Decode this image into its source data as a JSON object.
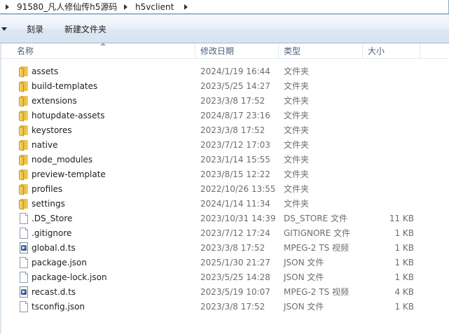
{
  "address": {
    "segments": [
      "91580_凡人修仙传h5源码",
      "h5vclient"
    ]
  },
  "toolbar": {
    "burn_label": "刻录",
    "new_folder_label": "新建文件夹"
  },
  "columns": {
    "name": "名称",
    "modified": "修改日期",
    "type": "类型",
    "size": "大小"
  },
  "files": [
    {
      "name": "assets",
      "modified": "2024/1/19 16:44",
      "type": "文件夹",
      "size": "",
      "icon": "folder-icon"
    },
    {
      "name": "build-templates",
      "modified": "2023/5/25 14:27",
      "type": "文件夹",
      "size": "",
      "icon": "folder-icon"
    },
    {
      "name": "extensions",
      "modified": "2023/3/8 17:52",
      "type": "文件夹",
      "size": "",
      "icon": "folder-icon"
    },
    {
      "name": "hotupdate-assets",
      "modified": "2024/8/17 23:16",
      "type": "文件夹",
      "size": "",
      "icon": "folder-icon"
    },
    {
      "name": "keystores",
      "modified": "2023/3/8 17:52",
      "type": "文件夹",
      "size": "",
      "icon": "folder-icon"
    },
    {
      "name": "native",
      "modified": "2023/7/12 17:03",
      "type": "文件夹",
      "size": "",
      "icon": "folder-icon"
    },
    {
      "name": "node_modules",
      "modified": "2023/1/14 15:55",
      "type": "文件夹",
      "size": "",
      "icon": "folder-icon"
    },
    {
      "name": "preview-template",
      "modified": "2023/8/15 12:22",
      "type": "文件夹",
      "size": "",
      "icon": "folder-icon"
    },
    {
      "name": "profiles",
      "modified": "2022/10/26 13:55",
      "type": "文件夹",
      "size": "",
      "icon": "folder-icon"
    },
    {
      "name": "settings",
      "modified": "2024/1/14 11:34",
      "type": "文件夹",
      "size": "",
      "icon": "folder-icon"
    },
    {
      "name": ".DS_Store",
      "modified": "2023/10/31 14:39",
      "type": "DS_STORE 文件",
      "size": "11 KB",
      "icon": "file-icon"
    },
    {
      "name": ".gitignore",
      "modified": "2023/7/12 17:24",
      "type": "GITIGNORE 文件",
      "size": "1 KB",
      "icon": "file-icon"
    },
    {
      "name": "global.d.ts",
      "modified": "2023/3/8 17:52",
      "type": "MPEG-2 TS 视频",
      "size": "1 KB",
      "icon": "video-file-icon"
    },
    {
      "name": "package.json",
      "modified": "2025/1/30 21:27",
      "type": "JSON 文件",
      "size": "1 KB",
      "icon": "file-icon"
    },
    {
      "name": "package-lock.json",
      "modified": "2023/5/25 14:28",
      "type": "JSON 文件",
      "size": "1 KB",
      "icon": "file-icon"
    },
    {
      "name": "recast.d.ts",
      "modified": "2023/5/19 10:07",
      "type": "MPEG-2 TS 视频",
      "size": "4 KB",
      "icon": "video-file-icon"
    },
    {
      "name": "tsconfig.json",
      "modified": "2023/3/8 17:52",
      "type": "JSON 文件",
      "size": "1 KB",
      "icon": "file-icon"
    }
  ]
}
